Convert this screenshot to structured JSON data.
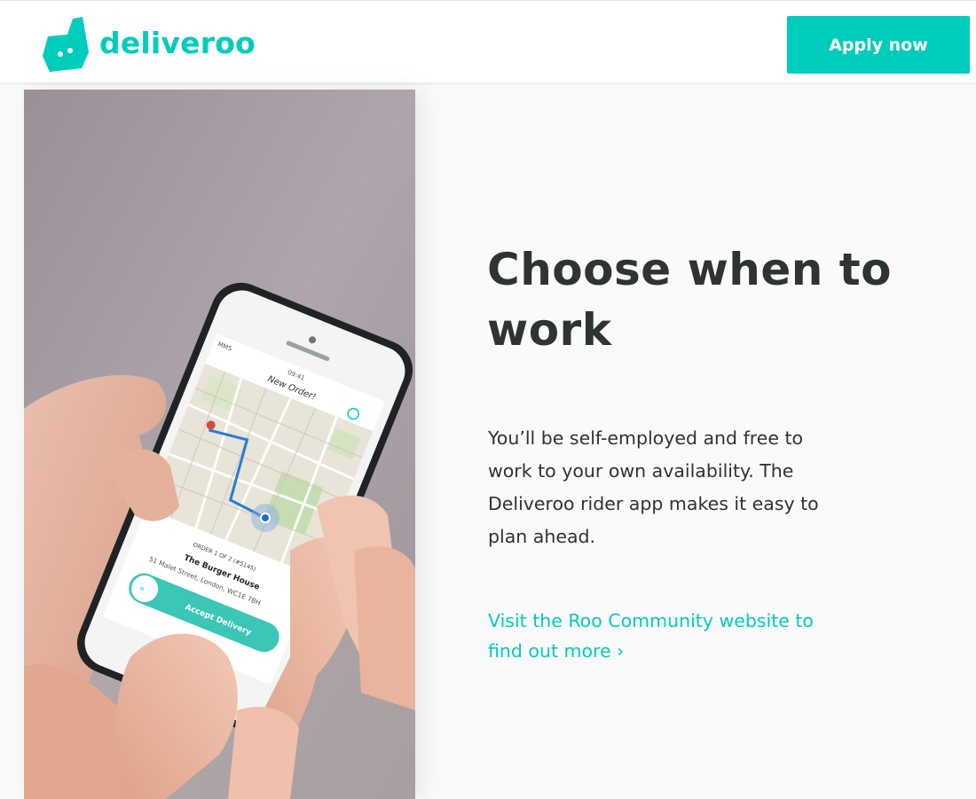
{
  "brand": {
    "name": "deliveroo",
    "color": "#00ccbc"
  },
  "header": {
    "apply_label": "Apply now"
  },
  "hero": {
    "title_line1": "Choose when to",
    "title_line2": "work",
    "body_lines": [
      "You’ll be self-employed and free to",
      "work to your own availability. The",
      "Deliveroo rider app makes it easy to",
      "plan ahead."
    ],
    "link_line1": "Visit the Roo Community website to",
    "link_line2": "find out more ›"
  },
  "phone_screen": {
    "carrier": "MMS",
    "time": "09:41",
    "screen_title": "New Order!",
    "order_label": "ORDER 1 OF 2 (#5145)",
    "restaurant": "The Burger House",
    "address": "51 Malet Street, London, WC1E 7BH",
    "slider_icon": "»",
    "accept_label": "Accept Delivery"
  }
}
